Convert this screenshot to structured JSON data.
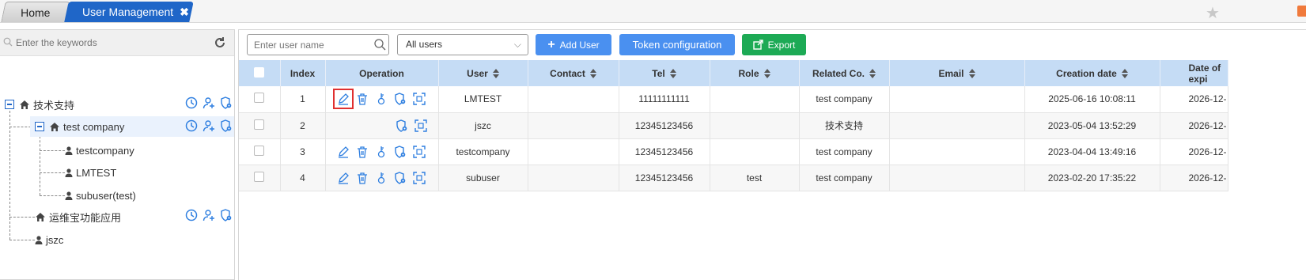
{
  "tabs": {
    "home_label": "Home",
    "active_label": "User Management",
    "close_glyph": "✖"
  },
  "tree": {
    "search_placeholder": "Enter the keywords",
    "nodes": [
      {
        "label": "技术支持",
        "type": "org"
      },
      {
        "label": "test company",
        "type": "org"
      },
      {
        "label": "testcompany",
        "type": "user"
      },
      {
        "label": "LMTEST",
        "type": "user"
      },
      {
        "label": "subuser(test)",
        "type": "user"
      },
      {
        "label": "运维宝功能应用",
        "type": "org"
      },
      {
        "label": "jszc",
        "type": "user"
      }
    ]
  },
  "toolbar": {
    "search_placeholder": "Enter user name",
    "filter_value": "All users",
    "add_user_label": "Add User",
    "token_label": "Token configuration",
    "export_label": "Export"
  },
  "table": {
    "headers": [
      "Index",
      "Operation",
      "User",
      "Contact",
      "Tel",
      "Role",
      "Related Co.",
      "Email",
      "Creation date",
      "Date of expi"
    ],
    "rows": [
      {
        "index": "1",
        "user": "LMTEST",
        "contact": "",
        "tel": "11111111111",
        "role": "",
        "related": "test company",
        "email": "",
        "created": "2025-06-16 10:08:11",
        "expiry": "2026-12-"
      },
      {
        "index": "2",
        "user": "jszc",
        "contact": "",
        "tel": "12345123456",
        "role": "",
        "related": "技术支持",
        "email": "",
        "created": "2023-05-04 13:52:29",
        "expiry": "2026-12-"
      },
      {
        "index": "3",
        "user": "testcompany",
        "contact": "",
        "tel": "12345123456",
        "role": "",
        "related": "test company",
        "email": "",
        "created": "2023-04-04 13:49:16",
        "expiry": "2026-12-"
      },
      {
        "index": "4",
        "user": "subuser",
        "contact": "",
        "tel": "12345123456",
        "role": "test",
        "related": "test company",
        "email": "",
        "created": "2023-02-20 17:35:22",
        "expiry": "2026-12-"
      }
    ]
  },
  "colors": {
    "accent_blue": "#1f66c8",
    "button_blue": "#4a90f0",
    "export_green": "#1daa55",
    "header_blue": "#c5dcf5",
    "icon_blue": "#2f7fe0",
    "highlight_red": "#e03030"
  },
  "icons": [
    "star-icon",
    "search-icon",
    "refresh-icon",
    "home-icon",
    "user-icon",
    "clock-icon",
    "add-user-icon",
    "shield-gear-icon",
    "edit-icon",
    "delete-icon",
    "key-icon",
    "scan-icon",
    "export-icon",
    "plus-icon",
    "sort-icon",
    "chevron-down-icon"
  ]
}
